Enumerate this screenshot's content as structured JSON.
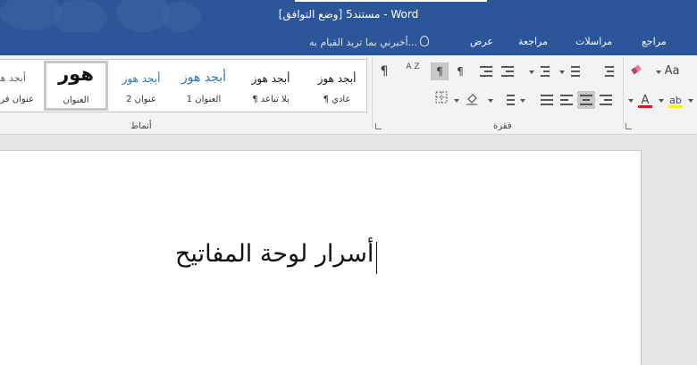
{
  "window": {
    "title": "مستند5 [وضع التوافق] - Word"
  },
  "menu": {
    "tabs": [
      "مراجع",
      "مراسلات",
      "مراجعة",
      "عرض"
    ],
    "tell_me": "أخبرني بما تريد القيام به..."
  },
  "ribbon": {
    "groups": {
      "styles": "أنماط",
      "paragraph": "فقرة"
    },
    "styles": [
      {
        "sample": "أبجد هوز",
        "name": "¶ عادي"
      },
      {
        "sample": "أبجد هوز",
        "name": "¶ بلا تباعد"
      },
      {
        "sample": "أبجد هوز",
        "name": "العنوان 1"
      },
      {
        "sample": "أبجد هوز",
        "name": "عنوان 2"
      },
      {
        "sample": "هور",
        "name": "العنوان"
      },
      {
        "sample": "أبجد هو",
        "name": "عنوان فرعي"
      }
    ],
    "font_buttons": {
      "change_case": "Aa",
      "font_color": "A",
      "highlight": "ab"
    },
    "paragraph_buttons": {
      "show_marks": "¶",
      "sort": "A Z"
    }
  },
  "document": {
    "text": "أسرار لوحة المفاتيح"
  },
  "colors": {
    "title_bar": "#2b579a",
    "ribbon_bg": "#f3f3f3",
    "heading_blue": "#2e74b5",
    "font_color_red": "#e81123",
    "highlight_yellow": "#fff200"
  }
}
